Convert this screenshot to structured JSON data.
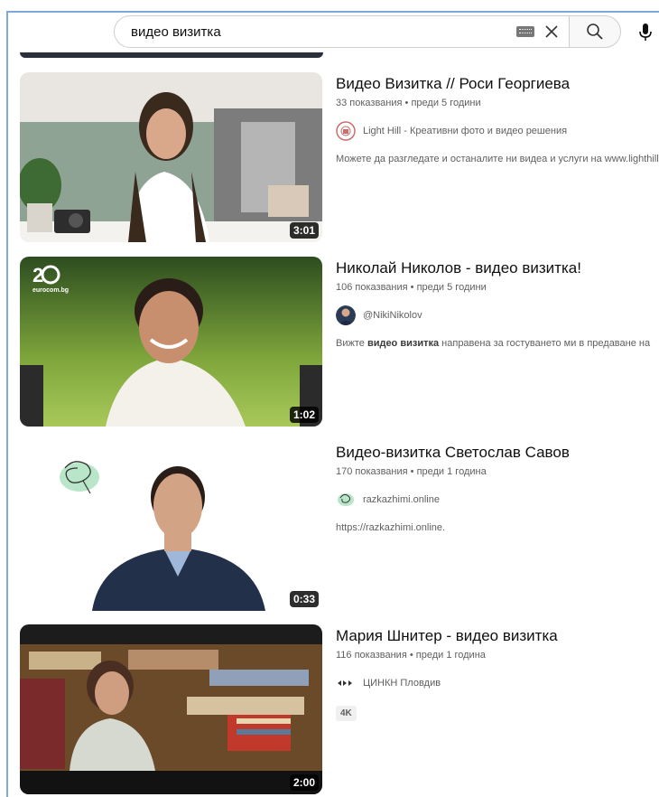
{
  "search": {
    "query": "видео визитка"
  },
  "results": [
    {
      "title": "Видео Визитка // Роси Георгиева",
      "views": "33 показвания",
      "age": "преди 5 години",
      "channel": "Light Hill - Креативни фото и видео решения",
      "description": "Можете да разгледате и останалите ни видеа и услуги на www.lighthill.bg",
      "duration": "3:01"
    },
    {
      "title": "Николай Николов - видео визитка!",
      "views": "106 показвания",
      "age": "преди 5 години",
      "channel": "@NikiNikolov",
      "desc_pre": "Вижте ",
      "desc_bold": "видео визитка",
      "desc_post": " направена за гостуването ми в предаване на",
      "duration": "1:02",
      "thumb_logo": "eurocom.bg"
    },
    {
      "title": "Видео-визитка Светослав Савов",
      "views": "170 показвания",
      "age": "преди 1 година",
      "channel": "razkazhimi.online",
      "description": "https://razkazhimi.online.",
      "duration": "0:33"
    },
    {
      "title": "Мария Шнитер - видео визитка",
      "views": "116 показвания",
      "age": "преди 1 година",
      "channel": "ЦИНКН Пловдив",
      "badge": "4K",
      "duration": "2:00"
    }
  ],
  "separator": " • "
}
